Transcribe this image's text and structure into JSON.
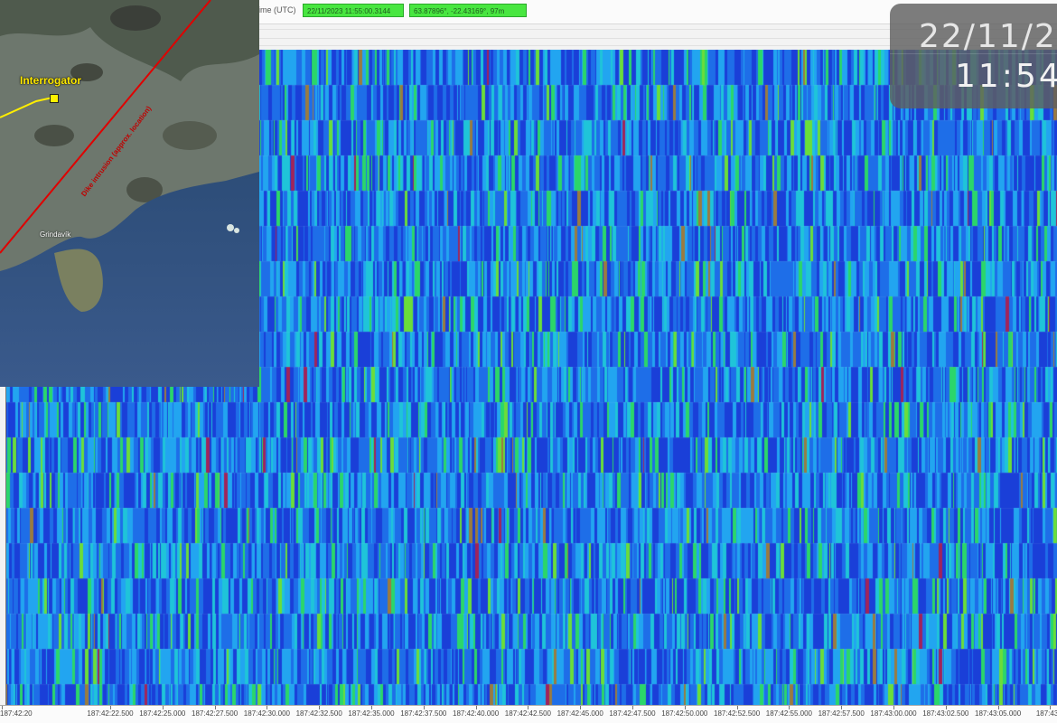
{
  "status_bar": {
    "time_label": "ime (UTC)",
    "time_value": "22/11/2023 11:55:00.3144",
    "coord_value": "63.87896°, -22.43169°, 97m"
  },
  "clock": {
    "date": "22/11/2",
    "time": "11:54"
  },
  "map": {
    "interrogator_label": "Interrogator",
    "town_label": "Grindavík",
    "line_label": "Dike intrusion (approx. location)"
  },
  "waterfall": {
    "colormap": [
      "#1a3fd8",
      "#1e6ee8",
      "#22a5f0",
      "#1fc4d9",
      "#2bd66a",
      "#6bdd3a",
      "#9a7b40",
      "#a0245a"
    ]
  },
  "x_axis": {
    "ticks": [
      "187:42:20",
      "187:42:22.500",
      "187:42:25.000",
      "187:42:27.500",
      "187:42:30.000",
      "187:42:32.500",
      "187:42:35.000",
      "187:42:37.500",
      "187:42:40.000",
      "187:42:42.500",
      "187:42:45.000",
      "187:42:47.500",
      "187:42:50.000",
      "187:42:52.500",
      "187:42:55.000",
      "187:42:57.500",
      "187:43:00.000",
      "187:43:02.500",
      "187:43:05.000",
      "187:43:0"
    ]
  }
}
